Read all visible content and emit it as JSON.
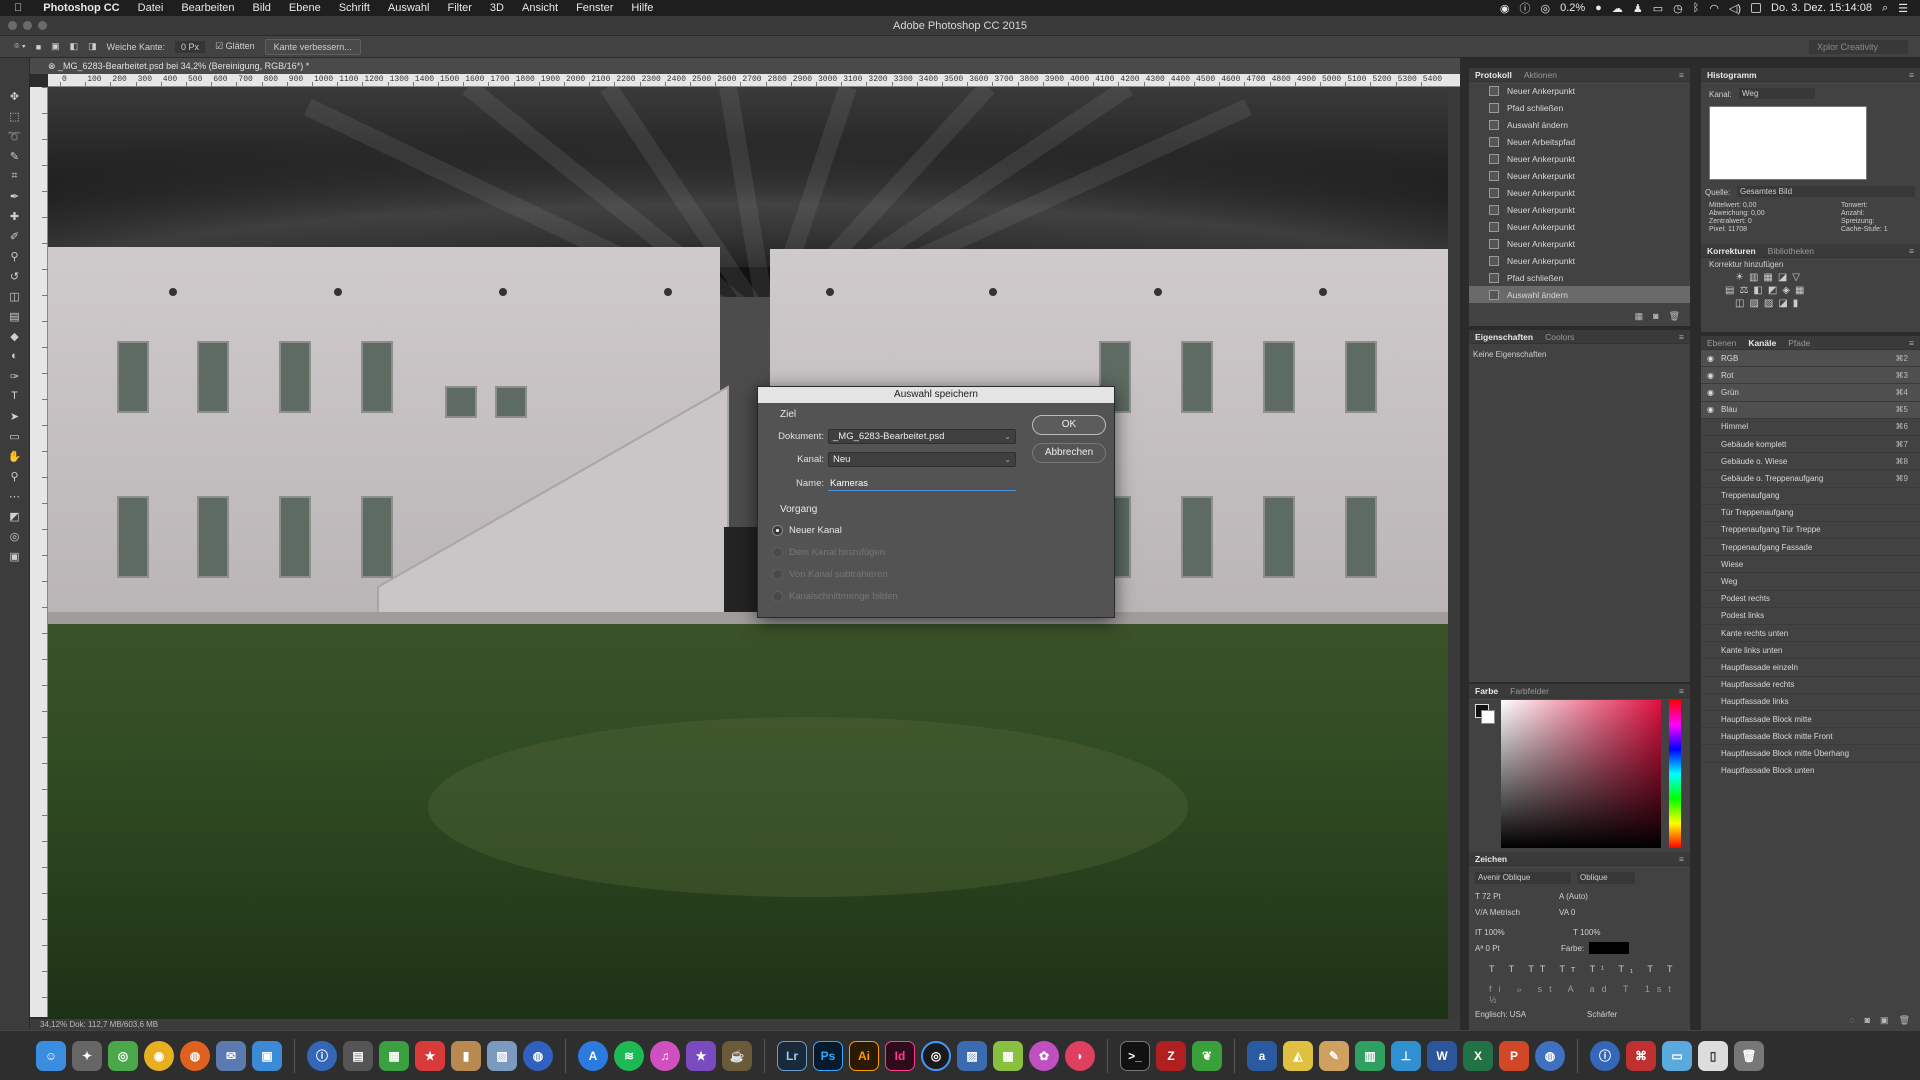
{
  "menubar": {
    "app": "Photoshop CC",
    "items": [
      "Datei",
      "Bearbeiten",
      "Bild",
      "Ebene",
      "Schrift",
      "Auswahl",
      "Filter",
      "3D",
      "Ansicht",
      "Fenster",
      "Hilfe"
    ],
    "battery": "0.2%",
    "clock": "Do. 3. Dez. 15:14:08"
  },
  "window": {
    "title": "Adobe Photoshop CC 2015"
  },
  "optionsbar": {
    "feather_label": "Weiche Kante:",
    "feather_value": "0 Px",
    "smooth_label": "Glätten",
    "refine_button": "Kante verbessern...",
    "workspace": "Xplor Creativity"
  },
  "document": {
    "tab": "_MG_6283-Bearbeitet.psd bei 34,2% (Bereinigung, RGB/16*) *",
    "status": "34,12%   Dok: 112,7 MB/603,6 MB",
    "ruler_marks": [
      "0",
      "100",
      "200",
      "300",
      "400",
      "500",
      "600",
      "700",
      "800",
      "900",
      "1000",
      "1100",
      "1200",
      "1300",
      "1400",
      "1500",
      "1600",
      "1700",
      "1800",
      "1900",
      "2000",
      "2100",
      "2200",
      "2300",
      "2400",
      "2500",
      "2600",
      "2700",
      "2800",
      "2900",
      "3000",
      "3100",
      "3200",
      "3300",
      "3400",
      "3500",
      "3600",
      "3700",
      "3800",
      "3900",
      "4000",
      "4100",
      "4200",
      "4300",
      "4400",
      "4500",
      "4600",
      "4700",
      "4800",
      "4900",
      "5000",
      "5100",
      "5200",
      "5300",
      "5400"
    ]
  },
  "dialog": {
    "title": "Auswahl speichern",
    "section_target": "Ziel",
    "document_label": "Dokument:",
    "document_value": "_MG_6283-Bearbeitet.psd",
    "channel_label": "Kanal:",
    "channel_value": "Neu",
    "name_label": "Name:",
    "name_value": "Kameras",
    "section_operation": "Vorgang",
    "ok": "OK",
    "cancel": "Abbrechen",
    "operations": [
      {
        "label": "Neuer Kanal",
        "enabled": true,
        "selected": true
      },
      {
        "label": "Dem Kanal hinzufügen",
        "enabled": false,
        "selected": false
      },
      {
        "label": "Von Kanal subtrahieren",
        "enabled": false,
        "selected": false
      },
      {
        "label": "Kanalschnittmenge bilden",
        "enabled": false,
        "selected": false
      }
    ]
  },
  "protocol": {
    "tabs": [
      "Protokoll",
      "Aktionen"
    ],
    "items": [
      "Neuer Ankerpunkt",
      "Pfad schließen",
      "Auswahl ändern",
      "Neuer Arbeitspfad",
      "Neuer Ankerpunkt",
      "Neuer Ankerpunkt",
      "Neuer Ankerpunkt",
      "Neuer Ankerpunkt",
      "Neuer Ankerpunkt",
      "Neuer Ankerpunkt",
      "Neuer Ankerpunkt",
      "Pfad schließen",
      "Auswahl ändern"
    ]
  },
  "properties": {
    "tabs": [
      "Eigenschaften",
      "Coolors"
    ],
    "empty": "Keine Eigenschaften"
  },
  "histogram": {
    "title": "Histogramm",
    "channel_label": "Kanal:",
    "channel_value": "Weg",
    "source_label": "Quelle:",
    "source_value": "Gesamtes Bild",
    "stats_left": [
      "Mittelwert: 0,00",
      "Abweichung: 0,00",
      "Zentralwert: 0",
      "Pixel: 11708"
    ],
    "stats_right": [
      "Tonwert:",
      "Anzahl:",
      "Spreizung:",
      "Cache-Stufe: 1"
    ]
  },
  "corrections": {
    "tabs": [
      "Korrekturen",
      "Bibliotheken"
    ],
    "add_label": "Korrektur hinzufügen"
  },
  "channels": {
    "tabs": [
      "Ebenen",
      "Kanäle",
      "Pfade"
    ],
    "items": [
      {
        "name": "RGB",
        "shortcut": "⌘2",
        "eye": true
      },
      {
        "name": "Rot",
        "shortcut": "⌘3",
        "eye": true
      },
      {
        "name": "Grün",
        "shortcut": "⌘4",
        "eye": true
      },
      {
        "name": "Blau",
        "shortcut": "⌘5",
        "eye": true
      },
      {
        "name": "Himmel",
        "shortcut": "⌘6",
        "eye": false
      },
      {
        "name": "Gebäude komplett",
        "shortcut": "⌘7",
        "eye": false
      },
      {
        "name": "Gebäude o. Wiese",
        "shortcut": "⌘8",
        "eye": false
      },
      {
        "name": "Gebäude o. Treppenaufgang",
        "shortcut": "⌘9",
        "eye": false
      },
      {
        "name": "Treppenaufgang",
        "shortcut": "",
        "eye": false
      },
      {
        "name": "Tür Treppenaufgang",
        "shortcut": "",
        "eye": false
      },
      {
        "name": "Treppenaufgang Tür Treppe",
        "shortcut": "",
        "eye": false
      },
      {
        "name": "Treppenaufgang Fassade",
        "shortcut": "",
        "eye": false
      },
      {
        "name": "Wiese",
        "shortcut": "",
        "eye": false
      },
      {
        "name": "Weg",
        "shortcut": "",
        "eye": false
      },
      {
        "name": "Podest rechts",
        "shortcut": "",
        "eye": false
      },
      {
        "name": "Podest links",
        "shortcut": "",
        "eye": false
      },
      {
        "name": "Kante rechts unten",
        "shortcut": "",
        "eye": false
      },
      {
        "name": "Kante links unten",
        "shortcut": "",
        "eye": false
      },
      {
        "name": "Hauptfassade einzeln",
        "shortcut": "",
        "eye": false
      },
      {
        "name": "Hauptfassade rechts",
        "shortcut": "",
        "eye": false
      },
      {
        "name": "Hauptfassade links",
        "shortcut": "",
        "eye": false
      },
      {
        "name": "Hauptfassade Block mitte",
        "shortcut": "",
        "eye": false
      },
      {
        "name": "Hauptfassade Block mitte Front",
        "shortcut": "",
        "eye": false
      },
      {
        "name": "Hauptfassade Block mitte Überhang",
        "shortcut": "",
        "eye": false
      },
      {
        "name": "Hauptfassade Block unten",
        "shortcut": "",
        "eye": false
      }
    ]
  },
  "color": {
    "tabs": [
      "Farbe",
      "Farbfelder"
    ]
  },
  "character": {
    "title": "Zeichen",
    "font": "Avenir Oblique",
    "style": "Oblique",
    "size": "72 Pt",
    "leading": "(Auto)",
    "kerning": "Metrisch",
    "tracking": "0",
    "vscale": "100%",
    "hscale": "100%",
    "baseline": "0 Pt",
    "color_label": "Farbe:",
    "language": "Englisch: USA",
    "antialias": "Schärfer"
  },
  "dock": {
    "apps": [
      "Lr",
      "Ps",
      "Ai",
      "Id"
    ]
  }
}
